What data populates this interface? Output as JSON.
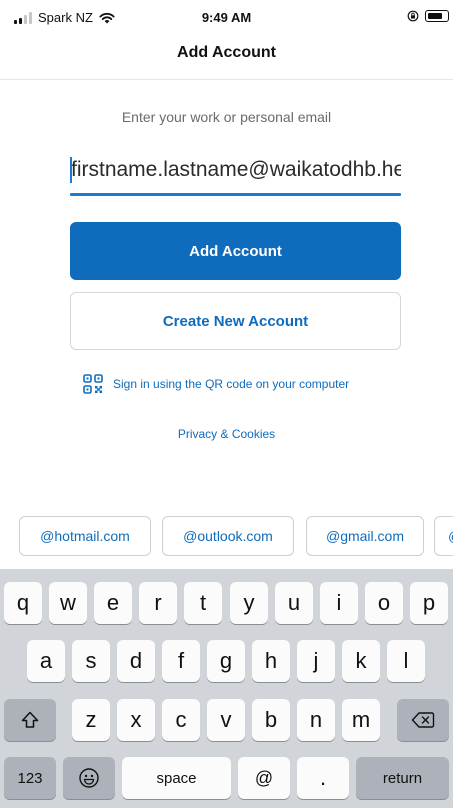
{
  "status_bar": {
    "carrier": "Spark NZ",
    "time": "9:49 AM"
  },
  "nav": {
    "title": "Add Account"
  },
  "form": {
    "prompt": "Enter your work or personal email",
    "email_value": "firstname.lastname@waikatodhb.he",
    "add_account_label": "Add Account",
    "create_account_label": "Create New Account",
    "qr_signin_label": "Sign in using the QR code on your computer",
    "privacy_label": "Privacy & Cookies"
  },
  "suggestions": [
    "@hotmail.com",
    "@outlook.com",
    "@gmail.com",
    "@"
  ],
  "keyboard": {
    "row1": [
      "q",
      "w",
      "e",
      "r",
      "t",
      "y",
      "u",
      "i",
      "o",
      "p"
    ],
    "row2": [
      "a",
      "s",
      "d",
      "f",
      "g",
      "h",
      "j",
      "k",
      "l"
    ],
    "row3": [
      "z",
      "x",
      "c",
      "v",
      "b",
      "n",
      "m"
    ],
    "numbers_label": "123",
    "space_label": "space",
    "at_label": "@",
    "dot_label": ".",
    "return_label": "return"
  },
  "colors": {
    "accent": "#0f6cbd",
    "caret": "#1b7bd4",
    "keyboard_bg": "#d1d4d9",
    "modifier_key": "#adb2ba"
  },
  "icons": [
    "signal-icon",
    "wifi-icon",
    "rotation-lock-icon",
    "battery-icon",
    "qr-code-icon",
    "shift-icon",
    "backspace-icon",
    "emoji-icon"
  ]
}
